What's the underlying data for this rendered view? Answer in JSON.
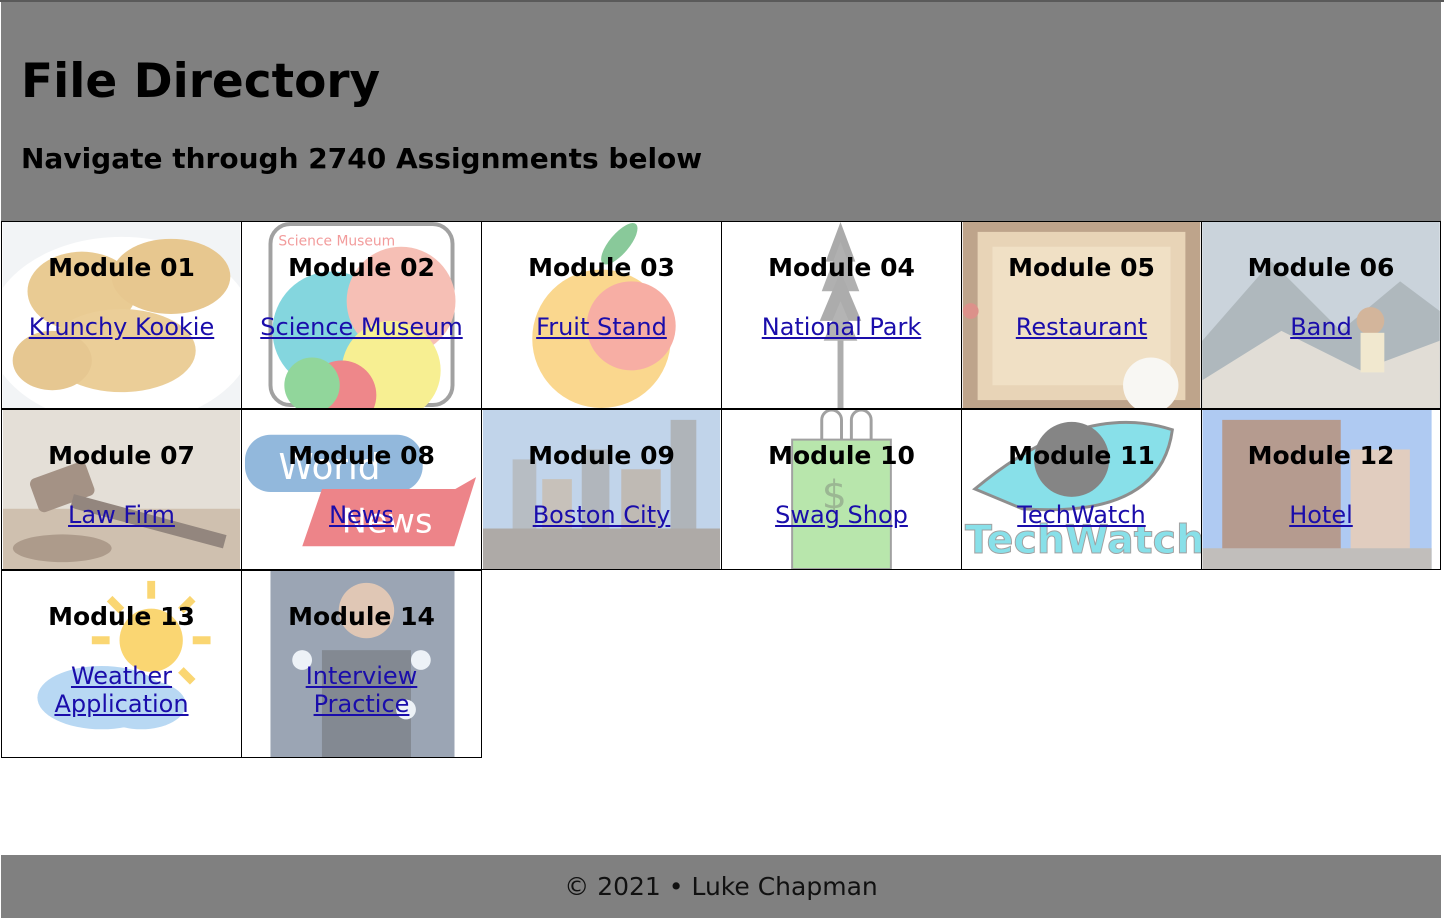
{
  "header": {
    "title": "File Directory",
    "subtitle": "Navigate through 2740 Assignments below"
  },
  "modules": [
    {
      "heading": "Module 01",
      "link": "Krunchy Kookie",
      "image_icon": "cookie-image"
    },
    {
      "heading": "Module 02",
      "link": "Science Museum",
      "image_icon": "science-museum-logo"
    },
    {
      "heading": "Module 03",
      "link": "Fruit Stand",
      "image_icon": "peach-image"
    },
    {
      "heading": "Module 04",
      "link": "National Park",
      "image_icon": "tree-image"
    },
    {
      "heading": "Module 05",
      "link": "Restaurant",
      "image_icon": "restaurant-menu-image"
    },
    {
      "heading": "Module 06",
      "link": "Band",
      "image_icon": "mountain-band-image"
    },
    {
      "heading": "Module 07",
      "link": "Law Firm",
      "image_icon": "gavel-image"
    },
    {
      "heading": "Module 08",
      "link": "News",
      "image_icon": "world-news-logo"
    },
    {
      "heading": "Module 09",
      "link": "Boston City",
      "image_icon": "boston-skyline-image"
    },
    {
      "heading": "Module 10",
      "link": "Swag Shop",
      "image_icon": "shopping-bag-image"
    },
    {
      "heading": "Module 11",
      "link": "TechWatch",
      "image_icon": "techwatch-eye-logo"
    },
    {
      "heading": "Module 12",
      "link": "Hotel",
      "image_icon": "hotel-building-image"
    },
    {
      "heading": "Module 13",
      "link": "Weather Application",
      "image_icon": "sun-cloud-image"
    },
    {
      "heading": "Module 14",
      "link": "Interview Practice",
      "image_icon": "businessman-image"
    }
  ],
  "logo_text": {
    "module_02": "Science Museum",
    "module_08_a": "World",
    "module_08_b": "News",
    "module_11": "TechWatch"
  },
  "footer": {
    "text": "© 2021 • Luke Chapman"
  },
  "colors": {
    "header_bg": "#808080",
    "footer_bg": "#808080",
    "link": "#1a0dab"
  }
}
